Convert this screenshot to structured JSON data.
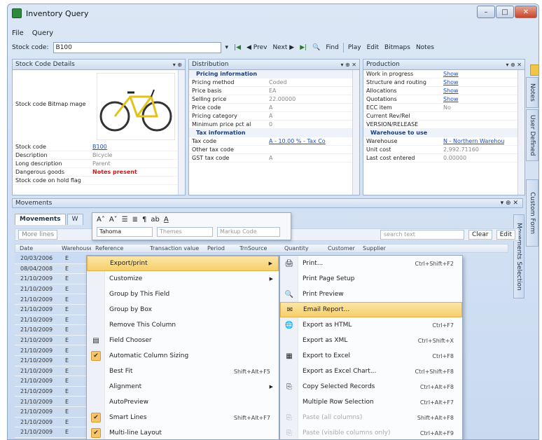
{
  "window": {
    "title": "Inventory Query",
    "controls": {
      "minimize": "–",
      "maximize": "□",
      "close": "✕"
    }
  },
  "menu": {
    "file": "File",
    "query": "Query"
  },
  "toolbar": {
    "stock_label": "Stock code:",
    "stock_value": "B100",
    "first": "|◀",
    "prev": "◀ Prev",
    "next": "Next ▶",
    "last": "▶|",
    "find": "Find",
    "play": "Play",
    "edit": "Edit",
    "bitmaps": "Bitmaps",
    "notes": "Notes"
  },
  "panes": {
    "stock": {
      "title": "Stock Code Details",
      "bitmap_label": "Stock code Bitmap mage",
      "rows": [
        {
          "k": "Stock code",
          "v": "B100",
          "style": "link"
        },
        {
          "k": "Description",
          "v": "Bicycle",
          "style": ""
        },
        {
          "k": "Long description",
          "v": "Parent",
          "style": ""
        },
        {
          "k": "Dangerous goods",
          "v": "Notes present",
          "style": "red"
        },
        {
          "k": "Stock code on hold flag",
          "v": "",
          "style": ""
        }
      ]
    },
    "distribution": {
      "title": "Distribution",
      "section1": "Pricing information",
      "section2": "Tax information",
      "rows1": [
        {
          "k": "Pricing method",
          "v": "Coded"
        },
        {
          "k": "Price basis",
          "v": "EA"
        },
        {
          "k": "Selling price",
          "v": "22.00000"
        },
        {
          "k": "Price code",
          "v": "A"
        },
        {
          "k": "Pricing category",
          "v": "A"
        },
        {
          "k": "Minimum price pct al",
          "v": "0"
        }
      ],
      "rows2": [
        {
          "k": "Tax code",
          "v": "A - 10.00 % - Tax Co",
          "style": "link"
        },
        {
          "k": "Other tax code",
          "v": "",
          "style": ""
        },
        {
          "k": "GST tax code",
          "v": "A",
          "style": ""
        }
      ]
    },
    "production": {
      "title": "Production",
      "section2": "Warehouse to use",
      "rows1": [
        {
          "k": "Work in progress",
          "v": "Show",
          "style": "link"
        },
        {
          "k": "Structure and routing",
          "v": "Show",
          "style": "link"
        },
        {
          "k": "Allocations",
          "v": "Show",
          "style": "link"
        },
        {
          "k": "Quotations",
          "v": "Show",
          "style": "link"
        },
        {
          "k": "ECC item",
          "v": "No",
          "style": ""
        },
        {
          "k": "Current Rev/Rel",
          "v": "",
          "style": ""
        },
        {
          "k": "VERSION/RELEASE",
          "v": "",
          "style": ""
        }
      ],
      "rows2": [
        {
          "k": "Warehouse",
          "v": "N - Northern Warehou",
          "style": "link"
        },
        {
          "k": "Unit cost",
          "v": "2,992.71160",
          "style": ""
        },
        {
          "k": "Last cost entered",
          "v": "0.00000",
          "style": ""
        }
      ]
    }
  },
  "side_tabs": {
    "notes": "Notes",
    "user_defined": "User Defined",
    "custom_form": "Custom Form",
    "movements_selection": "Movements Selection"
  },
  "movements": {
    "title": "Movements",
    "tabs": [
      "Movements",
      "W"
    ],
    "more_lines": "More lines",
    "font": "Tahoma",
    "themes": "Themes",
    "markup": "Markup Code",
    "search_placeholder": "search text",
    "clear": "Clear",
    "edit": "Edit",
    "columns": [
      "Date",
      "Warehouse",
      "Reference",
      "Transaction value",
      "Period",
      "TrnSource",
      "Quantity",
      "Customer",
      "Supplier"
    ],
    "rows": [
      {
        "date": "20/03/2006",
        "wh": "E"
      },
      {
        "date": "08/04/2008",
        "wh": "E"
      },
      {
        "date": "21/10/2009",
        "wh": "E"
      },
      {
        "date": "21/10/2009",
        "wh": "E"
      },
      {
        "date": "21/10/2009",
        "wh": "E"
      },
      {
        "date": "21/10/2009",
        "wh": "E"
      },
      {
        "date": "21/10/2009",
        "wh": "E"
      },
      {
        "date": "21/10/2009",
        "wh": "E"
      },
      {
        "date": "21/10/2009",
        "wh": "E"
      },
      {
        "date": "21/10/2009",
        "wh": "E"
      },
      {
        "date": "21/10/2009",
        "wh": "E"
      },
      {
        "date": "21/10/2009",
        "wh": "E"
      },
      {
        "date": "21/10/2009",
        "wh": "E"
      },
      {
        "date": "21/10/2009",
        "wh": "E"
      },
      {
        "date": "21/10/2009",
        "wh": "E"
      },
      {
        "date": "21/10/2009",
        "wh": "E"
      },
      {
        "date": "21/10/2009",
        "wh": "E"
      },
      {
        "date": "21/10/2009",
        "wh": "E"
      }
    ]
  },
  "context_menu": [
    {
      "label": "Export/print",
      "shortcut": "",
      "sub": true,
      "check": false,
      "icon": ""
    },
    {
      "label": "Customize",
      "shortcut": "",
      "sub": true,
      "check": false,
      "icon": ""
    },
    {
      "label": "Group by This Field",
      "shortcut": "",
      "sub": false,
      "check": false,
      "icon": ""
    },
    {
      "label": "Group by Box",
      "shortcut": "",
      "sub": false,
      "check": false,
      "icon": ""
    },
    {
      "label": "Remove This Column",
      "shortcut": "",
      "sub": false,
      "check": false,
      "icon": ""
    },
    {
      "label": "Field Chooser",
      "shortcut": "",
      "sub": false,
      "check": false,
      "icon": "▤"
    },
    {
      "label": "Automatic Column Sizing",
      "shortcut": "",
      "sub": false,
      "check": true,
      "icon": ""
    },
    {
      "label": "Best Fit",
      "shortcut": "Shift+Alt+F5",
      "sub": false,
      "check": false,
      "icon": ""
    },
    {
      "label": "Alignment",
      "shortcut": "",
      "sub": true,
      "check": false,
      "icon": ""
    },
    {
      "label": "AutoPreview",
      "shortcut": "",
      "sub": false,
      "check": false,
      "icon": ""
    },
    {
      "label": "Smart Lines",
      "shortcut": "Shift+Alt+F7",
      "sub": false,
      "check": true,
      "icon": ""
    },
    {
      "label": "Multi-line Layout",
      "shortcut": "",
      "sub": false,
      "check": true,
      "icon": ""
    }
  ],
  "submenu": [
    {
      "label": "Print...",
      "shortcut": "Ctrl+Shift+F2",
      "icon": "🖨",
      "dis": false
    },
    {
      "label": "Print Page Setup",
      "shortcut": "",
      "icon": "",
      "dis": false
    },
    {
      "label": "Print Preview",
      "shortcut": "",
      "icon": "🔍",
      "dis": false
    },
    {
      "label": "Email Report...",
      "shortcut": "",
      "icon": "✉",
      "dis": false
    },
    {
      "label": "Export as HTML",
      "shortcut": "Ctrl+F7",
      "icon": "🌐",
      "dis": false
    },
    {
      "label": "Export as XML",
      "shortcut": "Ctrl+Shift+X",
      "icon": "",
      "dis": false
    },
    {
      "label": "Export to Excel",
      "shortcut": "Ctrl+F8",
      "icon": "▦",
      "dis": false
    },
    {
      "label": "Export as Excel Chart...",
      "shortcut": "Ctrl+Shift+F8",
      "icon": "",
      "dis": false
    },
    {
      "label": "Copy Selected Records",
      "shortcut": "Ctrl+Alt+F8",
      "icon": "⎘",
      "dis": false
    },
    {
      "label": "Multiple Row Selection",
      "shortcut": "Ctrl+Alt+F7",
      "icon": "",
      "dis": false
    },
    {
      "label": "Paste (all columns)",
      "shortcut": "Shift+Alt+F8",
      "icon": "⎘",
      "dis": true
    },
    {
      "label": "Paste (visible columns only)",
      "shortcut": "Ctrl+Alt+F9",
      "icon": "⎘",
      "dis": true
    }
  ]
}
